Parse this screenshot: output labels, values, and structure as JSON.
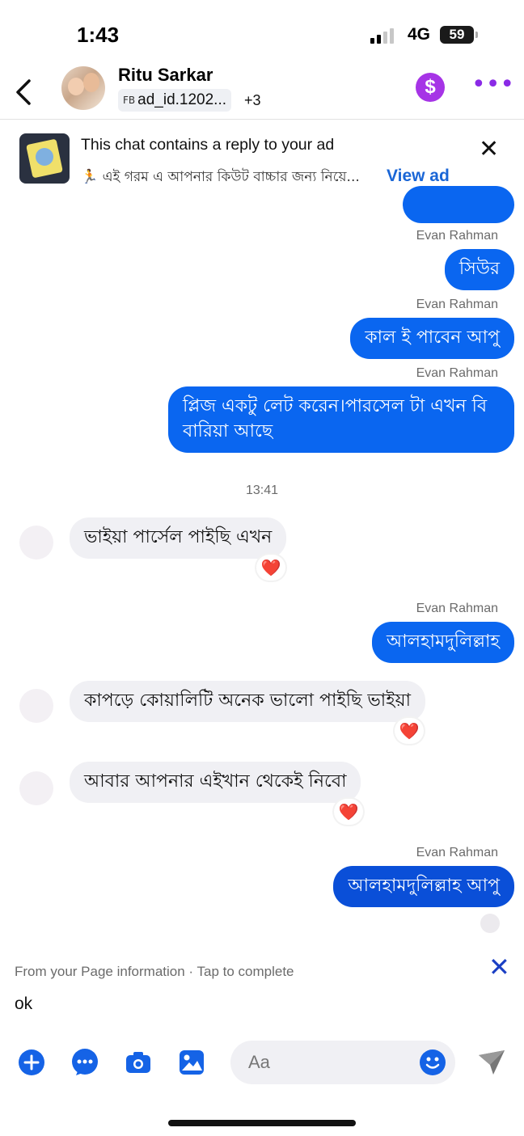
{
  "status_bar": {
    "time": "1:43",
    "network": "4G",
    "battery": "59"
  },
  "header": {
    "contact_name": "Ritu Sarkar",
    "ad_prefix": "FB",
    "ad_id": "ad_id.1202...",
    "extra_count": "+3"
  },
  "ad_banner": {
    "title": "This chat contains a reply to your ad",
    "subtitle": "🏃 এই গরম এ আপনার কিউট বাচ্চার জন্য নিয়ে...",
    "view_ad_label": "View ad"
  },
  "messages": [
    {
      "type": "out",
      "sender": "Evan Rahman",
      "text": "সিউর"
    },
    {
      "type": "out",
      "sender": "Evan Rahman",
      "text": "কাল ই পাবেন আপু"
    },
    {
      "type": "out",
      "sender": "Evan Rahman",
      "text": "প্লিজ একটু লেট করেন।পারসেল টা এখন বি বারিয়া আছে"
    },
    {
      "type": "time",
      "text": "13:41"
    },
    {
      "type": "in",
      "text": "ভাইয়া পার্সেল পাইছি এখন",
      "reaction": "❤️"
    },
    {
      "type": "out",
      "sender": "Evan Rahman",
      "text": "আলহামদুলিল্লাহ"
    },
    {
      "type": "in",
      "text": "কাপড়ে কোয়ালিটি অনেক ভালো পাইছি ভাইয়া",
      "reaction": "❤️"
    },
    {
      "type": "in",
      "text": "আবার আপনার এইখান থেকেই নিবো",
      "reaction": "❤️"
    },
    {
      "type": "out",
      "sender": "Evan Rahman",
      "text": "আলহামদুলিল্লাহ আপু"
    }
  ],
  "suggested_reply": {
    "label": "From your Page information · Tap to complete",
    "text": "ok"
  },
  "composer": {
    "placeholder": "Aa",
    "icons": [
      "add-icon",
      "more-options-icon",
      "camera-icon",
      "gallery-icon",
      "emoji-icon",
      "send-icon"
    ]
  },
  "colors": {
    "outgoing_bubble": "#0a66f0",
    "incoming_bubble": "#f0f0f4",
    "accent": "#1563e6",
    "dollar": "#a634e6"
  }
}
